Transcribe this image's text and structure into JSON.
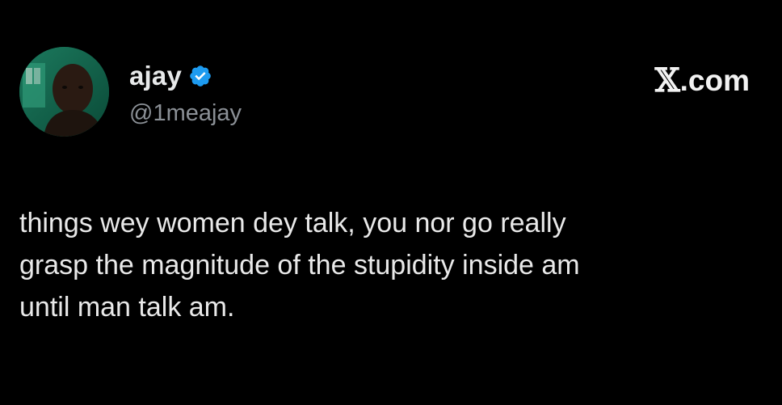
{
  "colors": {
    "background": "#000000",
    "text": "#e7e9ea",
    "secondary_text": "#8b9096",
    "verified_badge": "#1d9bf0",
    "avatar_background": "#0c5a45"
  },
  "author": {
    "display_name": "ajay",
    "handle": "@1meajay",
    "verified_icon": "verified-badge-icon",
    "avatar_icon": "profile-photo"
  },
  "brand": {
    "x_mark": "𝕏",
    "domain": ".com"
  },
  "tweet": {
    "text": "things wey women dey talk, you nor go really\ngrasp the magnitude of the stupidity inside am\nuntil man talk am."
  }
}
